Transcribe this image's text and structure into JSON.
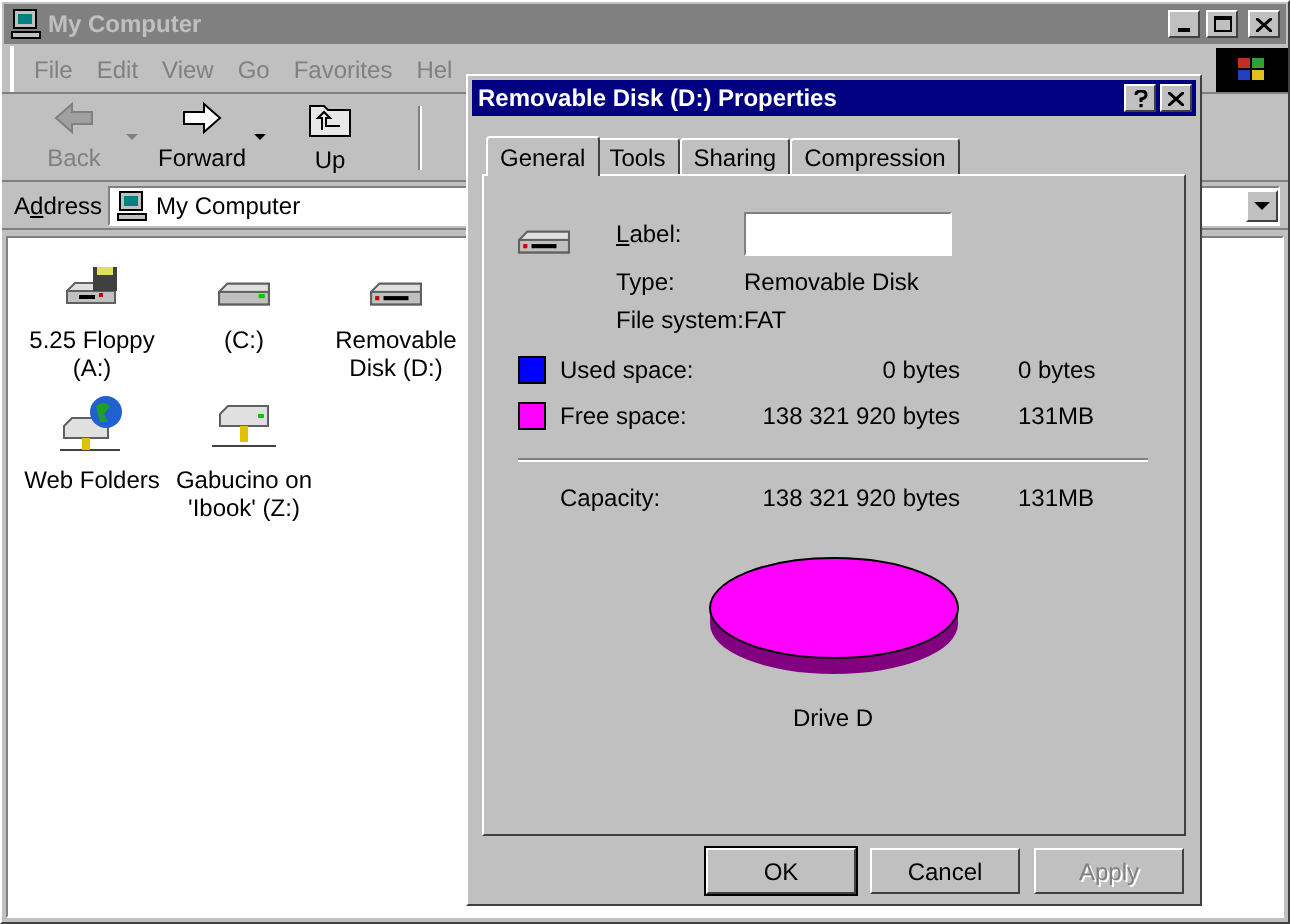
{
  "window": {
    "title": "My Computer",
    "active": false
  },
  "menu": [
    {
      "label": "File"
    },
    {
      "label": "Edit"
    },
    {
      "label": "View"
    },
    {
      "label": "Go"
    },
    {
      "label": "Favorites"
    },
    {
      "label": "Hel"
    }
  ],
  "toolbar": [
    {
      "label": "Back",
      "disabled": true,
      "dropdown": true,
      "kind": "back"
    },
    {
      "label": "Forward",
      "disabled": false,
      "dropdown": true,
      "kind": "forward"
    },
    {
      "label": "Up",
      "disabled": false,
      "dropdown": false,
      "kind": "up"
    }
  ],
  "address": {
    "label": "Address",
    "value": "My Computer"
  },
  "items": [
    {
      "label": "5.25 Floppy (A:)",
      "kind": "floppy"
    },
    {
      "label": "(C:)",
      "kind": "drive"
    },
    {
      "label": "Removable Disk (D:)",
      "kind": "removable"
    },
    {
      "label": "Web Folders",
      "kind": "web"
    },
    {
      "label": "Gabucino on 'Ibook' (Z:)",
      "kind": "network"
    }
  ],
  "dialog": {
    "title": "Removable Disk (D:) Properties",
    "tabs": [
      {
        "label": "General",
        "selected": true
      },
      {
        "label": "Tools",
        "selected": false
      },
      {
        "label": "Sharing",
        "selected": false
      },
      {
        "label": "Compression",
        "selected": false
      }
    ],
    "label_field": {
      "label": "Label:"
    },
    "info": [
      {
        "label": "Type:",
        "value": "Removable Disk"
      },
      {
        "label": "File system:",
        "value": "FAT"
      }
    ],
    "space": [
      {
        "label": "Used space:",
        "bytes": "0 bytes",
        "size": "0 bytes",
        "color": "#0000ff"
      },
      {
        "label": "Free space:",
        "bytes": "138 321 920 bytes",
        "size": "131MB",
        "color": "#ff00ff"
      }
    ],
    "capacity": {
      "label": "Capacity:",
      "bytes": "138 321 920 bytes",
      "size": "131MB"
    },
    "drive_caption": "Drive D",
    "buttons": [
      {
        "label": "OK",
        "disabled": false,
        "default": true
      },
      {
        "label": "Cancel",
        "disabled": false,
        "default": false
      },
      {
        "label": "Apply",
        "disabled": true,
        "default": false
      }
    ]
  }
}
